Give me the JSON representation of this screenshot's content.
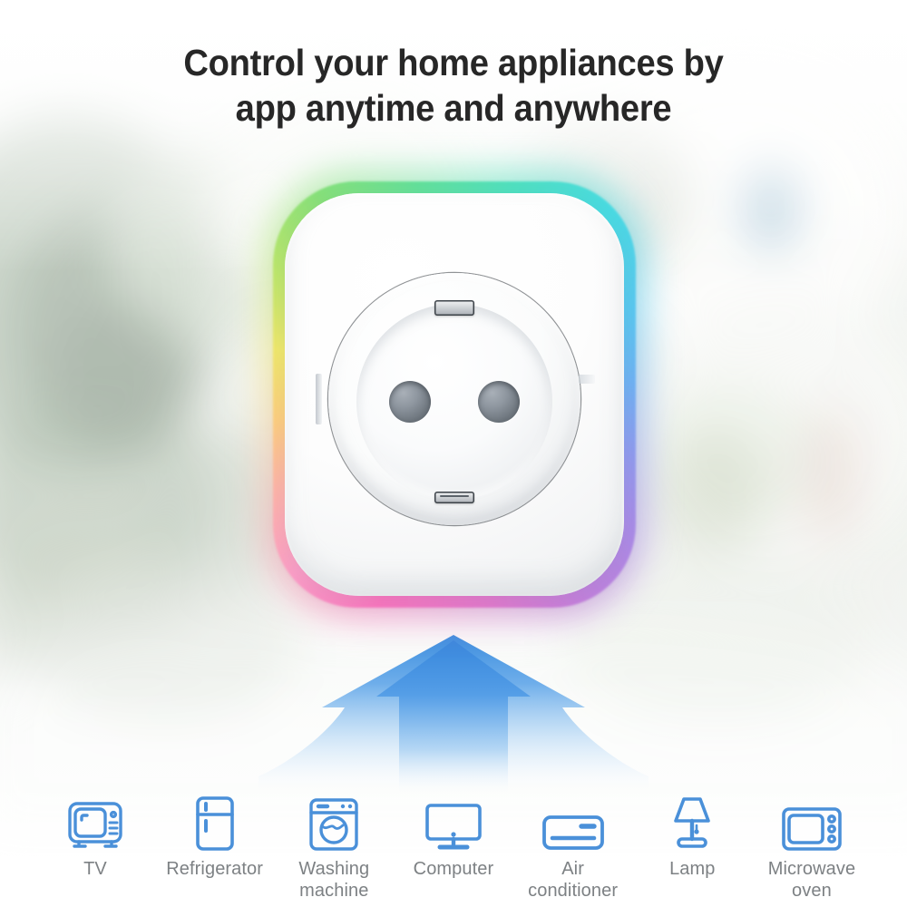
{
  "headline": {
    "line1": "Control your home appliances by",
    "line2": "app anytime and anywhere",
    "color": "#272727"
  },
  "product": {
    "name": "smart-wifi-plug",
    "type": "EU Schuko smart socket",
    "body_color": "#ffffff",
    "glow": {
      "description": "RGB rainbow ambient light ring",
      "stops": [
        "#ff74c0",
        "#ffb4a8",
        "#ffcf7e",
        "#f2e96a",
        "#86e07a",
        "#4fe0c0",
        "#49dbe2",
        "#6fb2f5",
        "#ab8ae8",
        "#e577cf"
      ]
    },
    "socket": {
      "pin_holes": 2,
      "earth_clips": 2
    }
  },
  "arrow": {
    "name": "upward-flow-arrow",
    "direction": "up",
    "color_top": "#3a8dde",
    "color_bottom": "#ffffff"
  },
  "appliances": [
    {
      "label": "TV",
      "icon": "tv-icon"
    },
    {
      "label": "Refrigerator",
      "icon": "refrigerator-icon"
    },
    {
      "label": "Washing\nmachine",
      "icon": "washing-machine-icon"
    },
    {
      "label": "Computer",
      "icon": "computer-icon"
    },
    {
      "label": "Air\nconditioner",
      "icon": "air-conditioner-icon"
    },
    {
      "label": "Lamp",
      "icon": "lamp-icon"
    },
    {
      "label": "Microwave\noven",
      "icon": "microwave-oven-icon"
    }
  ],
  "palette": {
    "icon_blue": "#4a90d9",
    "label_gray": "#7d8184",
    "background": "#f2f3f1"
  }
}
